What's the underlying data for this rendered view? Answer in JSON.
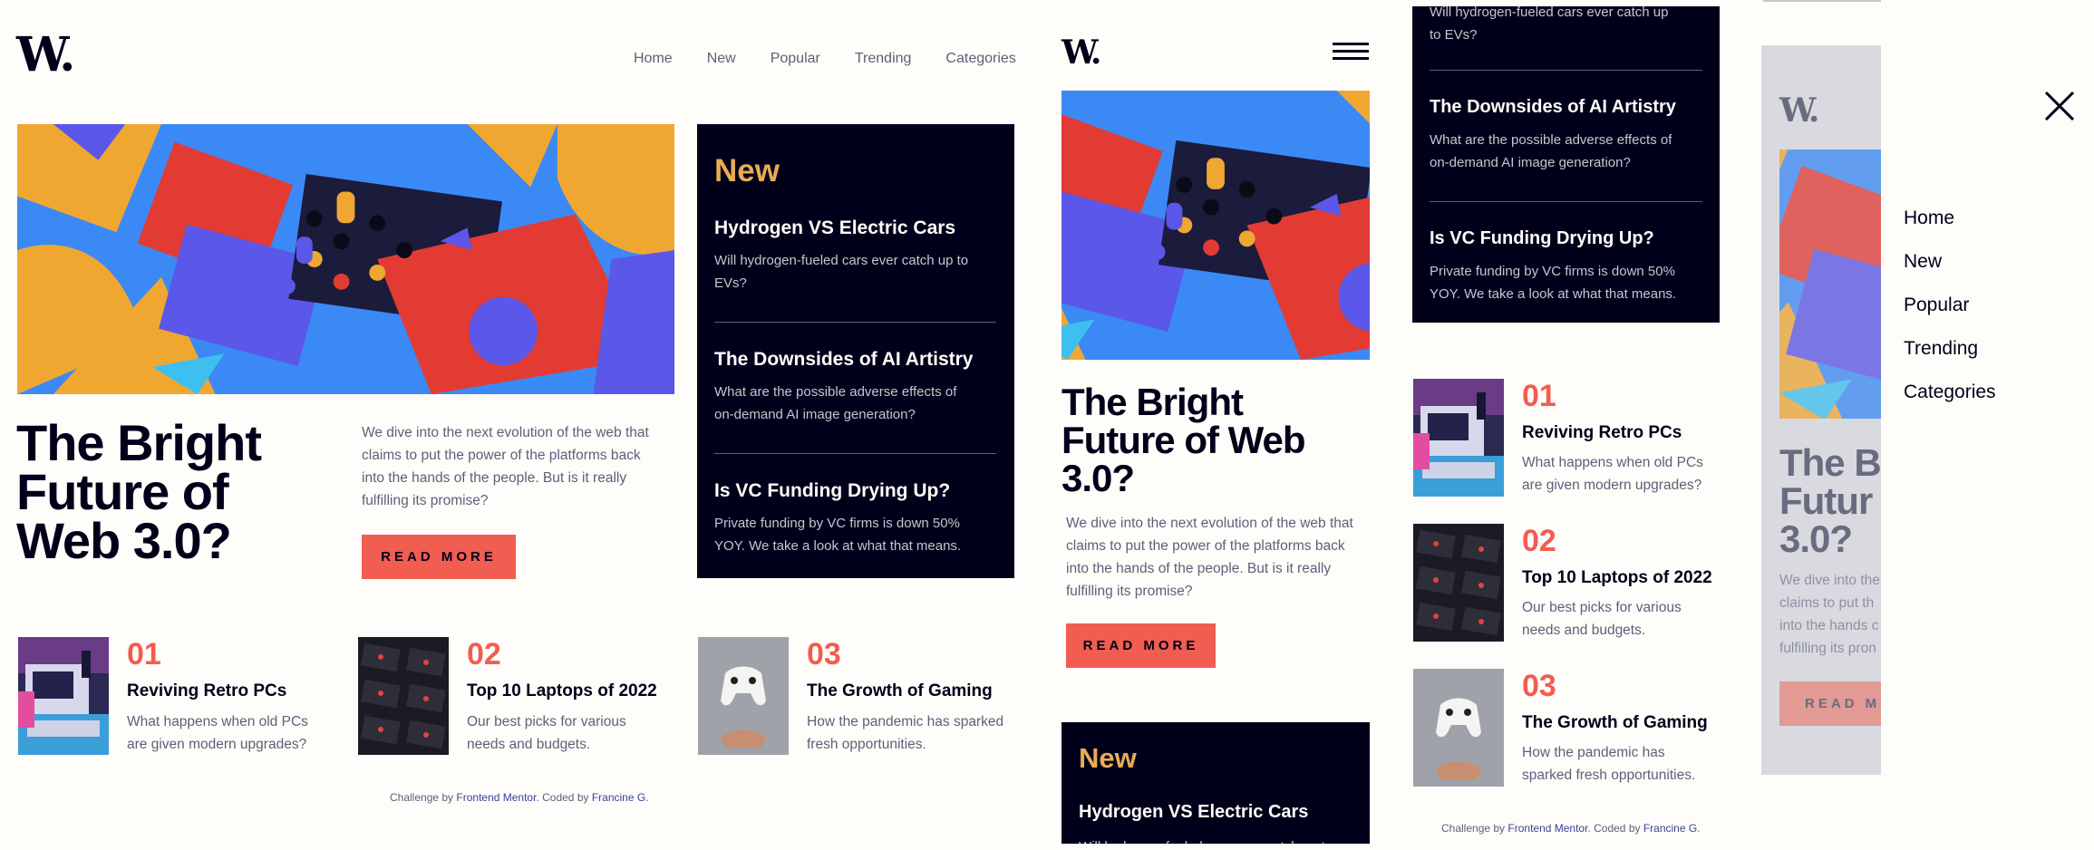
{
  "brand": {
    "logo": "W."
  },
  "nav": [
    "Home",
    "New",
    "Popular",
    "Trending",
    "Categories"
  ],
  "hero": {
    "title": "The Bright Future of Web 3.0?",
    "title_lines": [
      "The Bright",
      "Future of",
      "Web 3.0?"
    ],
    "mobile_title_lines": [
      "The Bright",
      "Future of Web",
      "3.0?"
    ],
    "desc_lines": [
      "We dive into the next evolution of the web that",
      "claims to put the power of the platforms back",
      "into the hands of the people. But is it really",
      "fulfilling its promise?"
    ],
    "mobile_desc_lines": [
      "We dive into the next evolution of the web that",
      "claims to put the power of the platforms back",
      "into the hands of the people. But is it really",
      "fulfilling its promise?"
    ],
    "button": "READ MORE"
  },
  "new_section": {
    "heading": "New",
    "items": [
      {
        "title": "Hydrogen VS Electric Cars",
        "desc_lines": [
          "Will hydrogen-fueled cars ever catch up to",
          "EVs?"
        ]
      },
      {
        "title": "The Downsides of AI Artistry",
        "desc_lines": [
          "What are the possible adverse effects of",
          "on-demand AI image generation?"
        ]
      },
      {
        "title": "Is VC Funding Drying Up?",
        "desc_lines": [
          "Private funding by VC firms is down 50%",
          "YOY. We take a look at what that means."
        ]
      }
    ],
    "partial_top_line_1": "Will hydrogen-fueled cars ever catch up",
    "partial_top_line_2": "to EVs?"
  },
  "articles": [
    {
      "num": "01",
      "title": "Reviving Retro PCs",
      "desc_lines": [
        "What happens when old PCs",
        "are given modern upgrades?"
      ],
      "mobile_desc_lines": [
        "What happens when old PCs",
        "are given modern upgrades?"
      ]
    },
    {
      "num": "02",
      "title": "Top 10 Laptops of 2022",
      "desc_lines": [
        "Our best picks for various",
        "needs and budgets."
      ],
      "mobile_desc_lines": [
        "Our best picks for various",
        "needs and budgets."
      ]
    },
    {
      "num": "03",
      "title": "The Growth of Gaming",
      "desc_lines": [
        "How the pandemic has sparked",
        "fresh opportunities."
      ],
      "mobile_desc_lines": [
        "How the pandemic has",
        "sparked fresh opportunities."
      ]
    }
  ],
  "footer": {
    "prefix": "Challenge by ",
    "fm": "Frontend Mentor",
    "mid": ". Coded by ",
    "author": "Francine G",
    "end": "."
  },
  "menu_overlay": {
    "close_icon": "close-icon",
    "items": [
      "Home",
      "New",
      "Popular",
      "Trending",
      "Categories"
    ],
    "faded_title_lines": [
      "The B",
      "Futur",
      "3.0?"
    ],
    "faded_desc_lines": [
      "We dive into the",
      "claims to put th",
      "into the hands c",
      "fulfilling its pron"
    ],
    "faded_button": "READ MO"
  },
  "colors": {
    "bg": "#fffdf9",
    "dark": "#00001a",
    "accent": "#f15d51",
    "gold": "#e9ab53",
    "muted": "#5d5f79"
  }
}
